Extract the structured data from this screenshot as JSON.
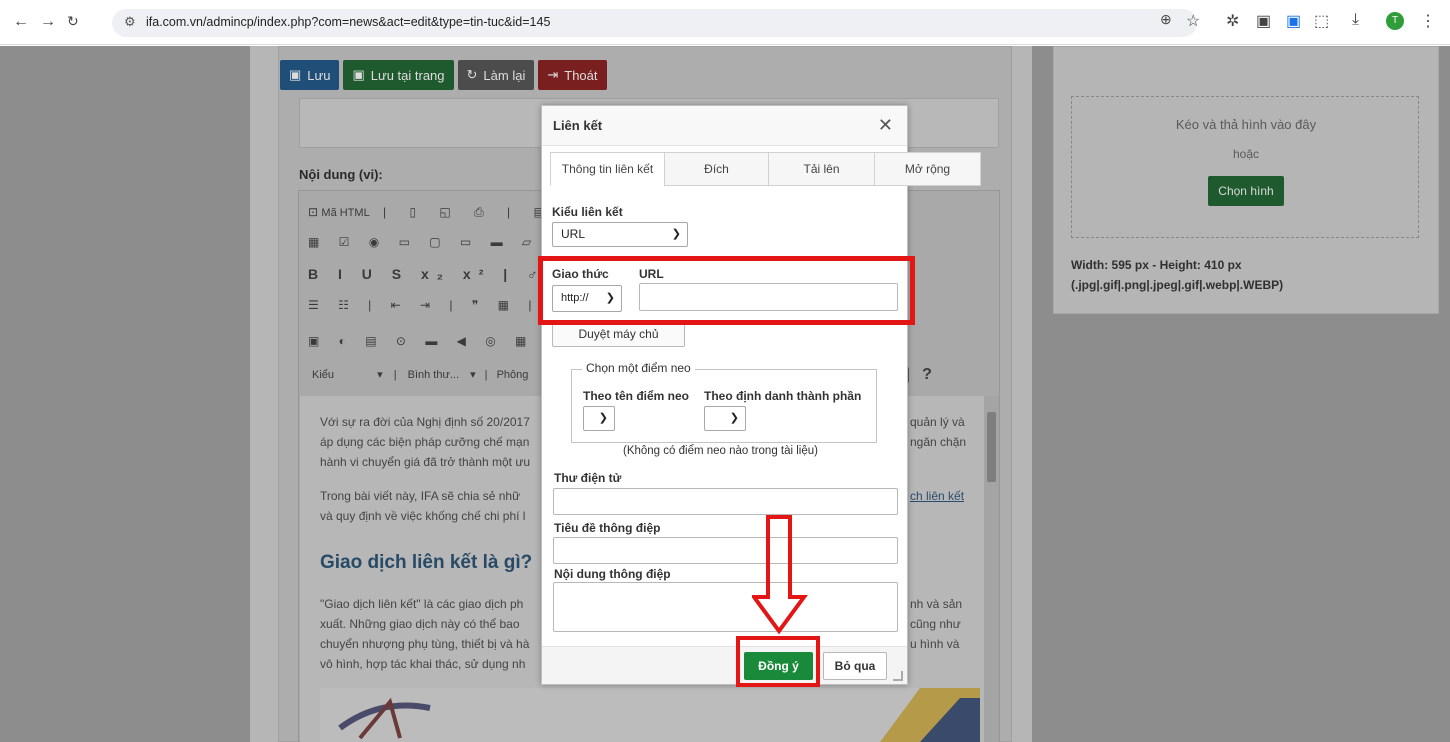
{
  "browser": {
    "url": "ifa.com.vn/admincp/index.php?com=news&act=edit&type=tin-tuc&id=145",
    "avatar_letter": "T"
  },
  "toolbar": {
    "save": "Lưu",
    "save_stay": "Lưu tại trang",
    "reset": "Làm lại",
    "exit": "Thoát"
  },
  "editor": {
    "content_label": "Nội dung (vi):",
    "source_label": "Mã HTML",
    "style_label": "Kiểu",
    "format_label": "Bình thư...",
    "font_label": "Phông",
    "help_label": "?",
    "para1_line1": "Với sự ra đời của Nghị định số 20/2017",
    "para1_line2": "áp dụng các biện pháp cưỡng chế mạn",
    "para1_line3": "hành vi chuyển giá đã trở thành một ưu",
    "para2_line1": "Trong bài viết này, IFA sẽ chia sẻ nhữ",
    "para2_line2": "và quy định về việc khống chế chi phí l",
    "heading": "Giao dịch liên kết là gì?",
    "para3_line1": "\"Giao dịch liên kết\" là các giao dịch ph",
    "para3_line2": "xuất. Những giao dịch này có thể bao",
    "para3_line3": "chuyển nhượng phụ tùng, thiết bị và hà",
    "para3_line4": "vô hình, hợp tác khai thác, sử dụng nh",
    "right1": "quản lý và",
    "right2": "ngăn chặn",
    "right3": "ch liên kết",
    "right4": "nh và sản",
    "right5": "cũng như",
    "right6": "u hình và"
  },
  "upload": {
    "drop_text": "Kéo và thả hình vào đây",
    "or_text": "hoặc",
    "choose_button": "Chọn hình",
    "dimensions": "Width: 595 px - Height: 410 px",
    "formats": "(.jpg|.gif|.png|.jpeg|.gif|.webp|.WEBP)"
  },
  "dialog": {
    "title": "Liên kết",
    "tabs": [
      "Thông tin liên kết",
      "Đích",
      "Tải lên",
      "Mở rộng"
    ],
    "link_type_label": "Kiểu liên kết",
    "link_type_value": "URL",
    "protocol_label": "Giao thức",
    "protocol_value": "http://",
    "url_label": "URL",
    "url_value": "",
    "browse_button": "Duyệt máy chủ",
    "anchor_legend": "Chọn một điểm neo",
    "by_anchor_name": "Theo tên điểm neo",
    "by_element_id": "Theo định danh thành phần",
    "no_anchor_note": "(Không có điểm neo nào trong tài liệu)",
    "email_label": "Thư điện tử",
    "subject_label": "Tiêu đề thông điệp",
    "body_label": "Nội dung thông điệp",
    "ok_button": "Đồng ý",
    "cancel_button": "Bỏ qua"
  },
  "colors": {
    "annotation_red": "#e41515",
    "ok_green": "#198a3a"
  }
}
